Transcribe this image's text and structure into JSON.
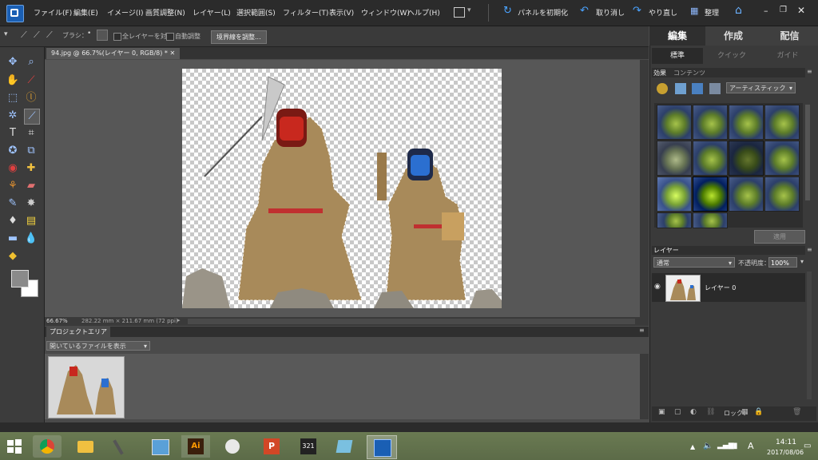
{
  "menubar": {
    "items": [
      "ファイル(F)",
      "編集(E)",
      "イメージ(I)",
      "画質調整(N)",
      "レイヤー(L)",
      "選択範囲(S)",
      "フィルター(T)",
      "表示(V)",
      "ウィンドウ(W)",
      "ヘルプ(H)"
    ],
    "reset_panels": "パネルを初期化",
    "undo": "取り消し",
    "redo": "やり直し",
    "organize": "整理"
  },
  "options": {
    "brush_label": "ブラシ：",
    "all_layers": "全レイヤーを対象",
    "auto_enhance": "自動調整",
    "refine_edge": "境界線を調整..."
  },
  "document": {
    "tab_title": "94.jpg @ 66.7%(レイヤー 0, RGB/8) *",
    "zoom": "66.67%",
    "dimensions": "282.22 mm × 211.67 mm (72 ppi)"
  },
  "project": {
    "title": "プロジェクトエリア",
    "dropdown": "開いているファイルを表示"
  },
  "right_panel": {
    "main_tabs": [
      "編集",
      "作成",
      "配信"
    ],
    "sub_tabs": [
      "標準",
      "クイック",
      "ガイド"
    ],
    "effects_tabs": [
      "効果",
      "コンテンツ"
    ],
    "effects_dropdown": "アーティスティック",
    "apply": "適用",
    "layers_title": "レイヤー",
    "blend_mode": "通常",
    "opacity_label": "不透明度：",
    "opacity_value": "100%",
    "layer_name": "レイヤー 0",
    "lock_label": "ロック："
  },
  "taskbar": {
    "time": "14:11",
    "date": "2017/08/06",
    "ime": "A"
  },
  "colors": {
    "accent": "#1a5fb4",
    "panel_bg": "#3a3a3a"
  }
}
